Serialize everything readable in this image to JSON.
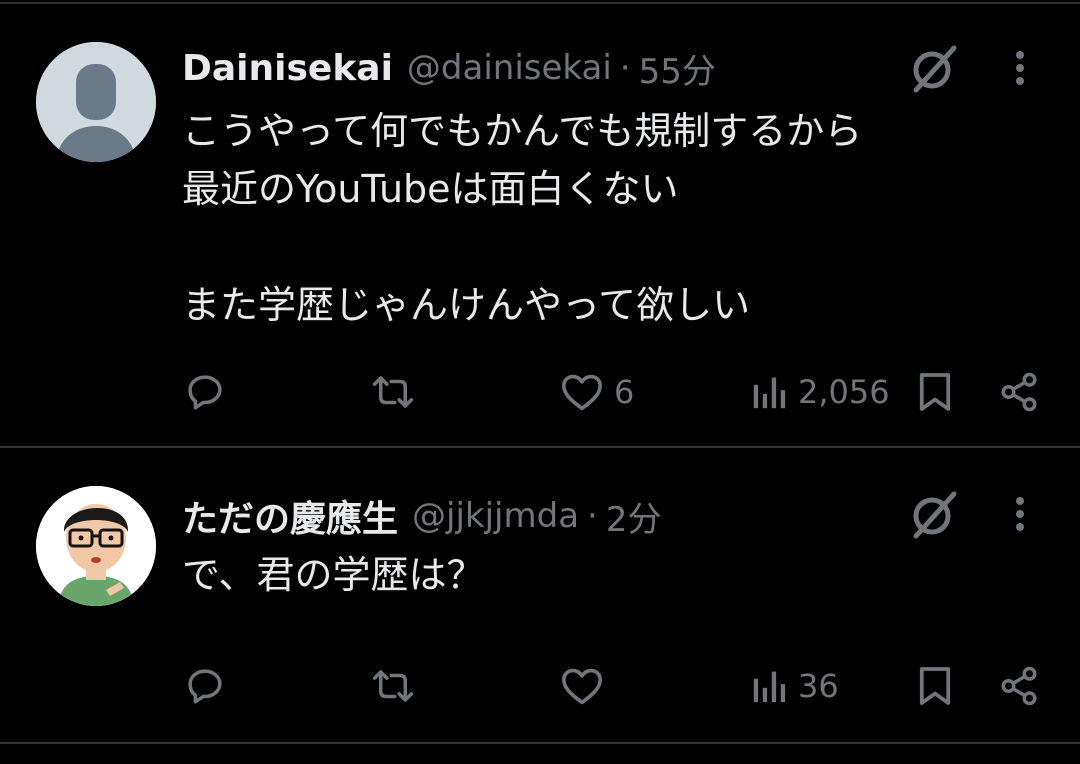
{
  "tweets": [
    {
      "name": "Dainisekai",
      "handle": "@dainisekai",
      "separator": "·",
      "time": "55分",
      "text": "こうやって何でもかんでも規制するから\n最近のYouTubeは面白くない\n\nまた学歴じゃんけんやって欲しい",
      "likes": "6",
      "views": "2,056",
      "avatar": "default-avatar-icon"
    },
    {
      "name": "ただの慶應生",
      "handle": "@jjkjjmda",
      "separator": "·",
      "time": "2分",
      "text": "で、君の学歴は？",
      "likes": "",
      "views": "36",
      "avatar": "illustrated-avatar"
    }
  ],
  "colors": {
    "background": "#000000",
    "text": "#e7e9ea",
    "secondary": "#71767b",
    "divider": "#2f3336"
  },
  "icons": [
    "reply-icon",
    "retweet-icon",
    "like-icon",
    "views-icon",
    "bookmark-icon",
    "share-icon",
    "grok-icon",
    "more-icon"
  ]
}
